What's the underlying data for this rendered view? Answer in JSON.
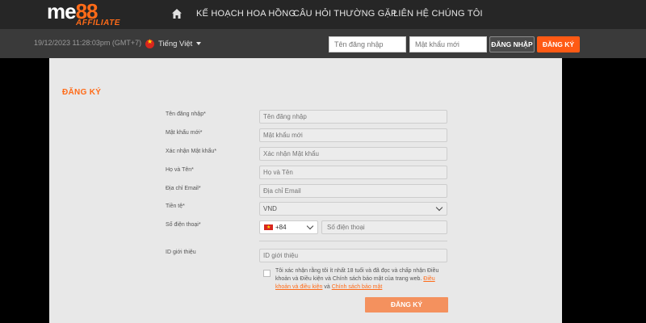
{
  "header": {
    "logo_main": "me88",
    "logo_sub": "AFFILIATE",
    "nav": [
      {
        "label": "KẾ HOẠCH HOA HỒNG"
      },
      {
        "label": "CÂU HỎI THƯỜNG GẶP"
      },
      {
        "label": "LIÊN HỆ CHÚNG TÔI"
      }
    ]
  },
  "subbar": {
    "datetime": "19/12/2023 11:28:03pm (GMT+7)",
    "language": "Tiếng Việt",
    "username_placeholder": "Tên đăng nhập",
    "password_placeholder": "Mật khẩu mới",
    "login_label": "ĐĂNG NHẬP",
    "register_label": "ĐĂNG KÝ"
  },
  "form": {
    "title": "ĐĂNG KÝ",
    "fields": [
      {
        "label": "Tên đăng nhập*",
        "placeholder": "Tên đăng nhập"
      },
      {
        "label": "Mật khẩu mới*",
        "placeholder": "Mật khẩu mới"
      },
      {
        "label": "Xác nhận Mật khẩu*",
        "placeholder": "Xác nhận Mật khẩu"
      },
      {
        "label": "Họ và Tên*",
        "placeholder": "Họ và Tên"
      },
      {
        "label": "Địa chỉ Email*",
        "placeholder": "Địa chỉ Email"
      },
      {
        "label": "Tiền tệ*",
        "value": "VND"
      },
      {
        "label": "Số điện thoại*",
        "code": "+84",
        "placeholder": "Số điện thoại"
      },
      {
        "label": "ID giới thiệu",
        "placeholder": "ID giới thiệu"
      }
    ],
    "consent_text": "Tôi xác nhận rằng tôi ít nhất 18 tuổi và đã đọc và chấp nhận Điều khoản và Điều kiện và Chính sách bảo mật của trang web.",
    "terms_link": "Điều khoản và điều kiện",
    "and_text": "và",
    "privacy_link": "Chính sách bảo mật",
    "submit_label": "ĐĂNG KÝ"
  },
  "colors": {
    "accent": "#ff5a14",
    "submit_bg": "#f4915e",
    "panel_bg": "#e8e8e8"
  }
}
